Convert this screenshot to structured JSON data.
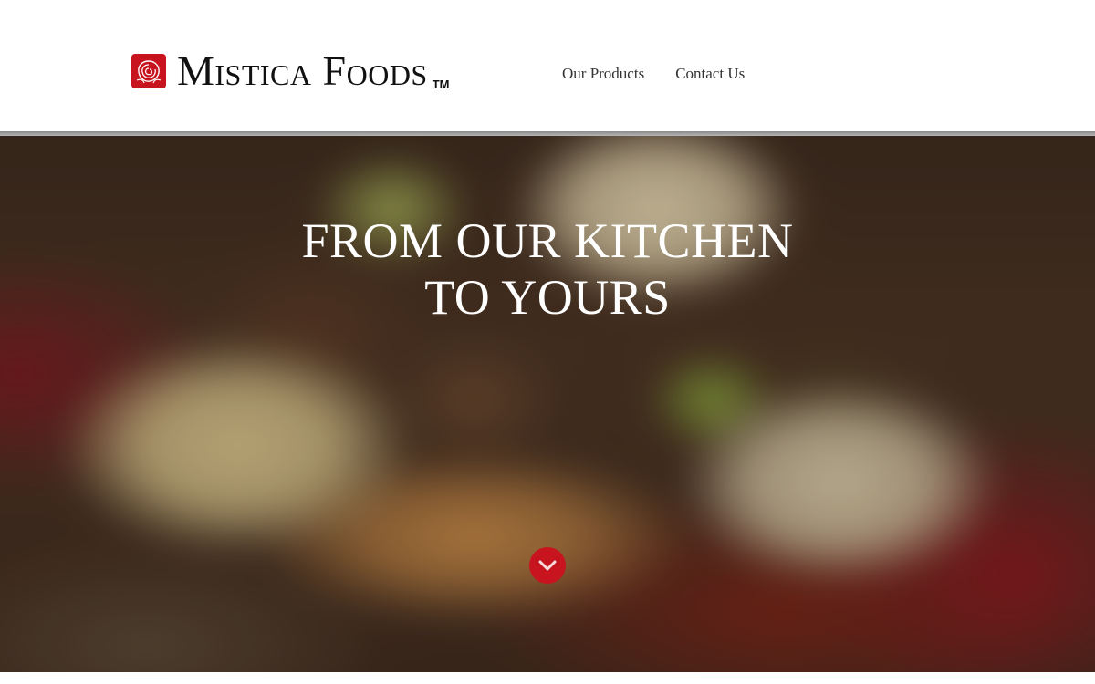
{
  "brand": {
    "name": "Mistica Foods",
    "trademark": "TM",
    "logo_icon": "rose-icon",
    "accent_color": "#c8141e"
  },
  "nav": {
    "items": [
      {
        "label": "Our Products"
      },
      {
        "label": "Contact Us"
      }
    ]
  },
  "hero": {
    "title_line1": "FROM OUR KITCHEN",
    "title_line2": "TO YOURS",
    "scroll_icon": "chevron-down-icon"
  }
}
